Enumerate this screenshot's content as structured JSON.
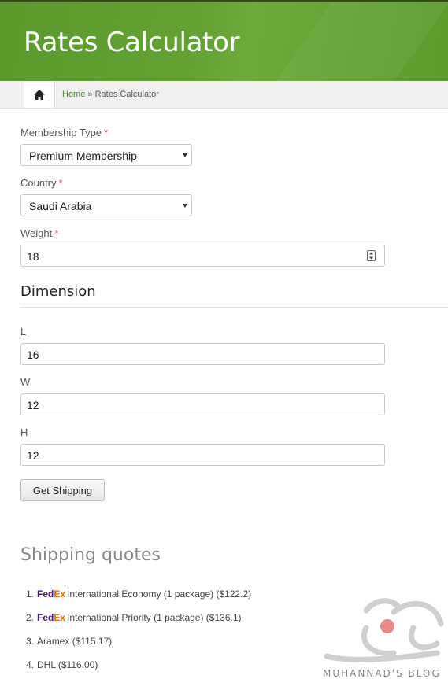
{
  "page": {
    "title": "Rates Calculator"
  },
  "breadcrumb": {
    "home": "Home",
    "separator": "»",
    "current": "Rates Calculator"
  },
  "form": {
    "membership": {
      "label": "Membership Type",
      "required": "*",
      "value": "Premium Membership"
    },
    "country": {
      "label": "Country",
      "required": "*",
      "value": "Saudi Arabia"
    },
    "weight": {
      "label": "Weight",
      "required": "*",
      "value": "18"
    },
    "dimension_title": "Dimension",
    "length": {
      "label": "L",
      "value": "16"
    },
    "width": {
      "label": "W",
      "value": "12"
    },
    "height": {
      "label": "H",
      "value": "12"
    },
    "submit_label": "Get Shipping"
  },
  "quotes": {
    "title": "Shipping quotes",
    "items": [
      {
        "num": "1.",
        "carrier_logo": "FedEx",
        "text": "International Economy (1 package) ($122.2)"
      },
      {
        "num": "2.",
        "carrier_logo": "FedEx",
        "text": "International Priority (1 package) ($136.1)"
      },
      {
        "num": "3.",
        "text": "Aramex ($115.17)"
      },
      {
        "num": "4.",
        "text": "DHL ($116.00)"
      }
    ]
  },
  "watermark": {
    "text": "MUHANNAD'S BLOG"
  },
  "colors": {
    "header": "#5f9e30",
    "link": "#4b8a2a",
    "required": "#d9534f"
  }
}
